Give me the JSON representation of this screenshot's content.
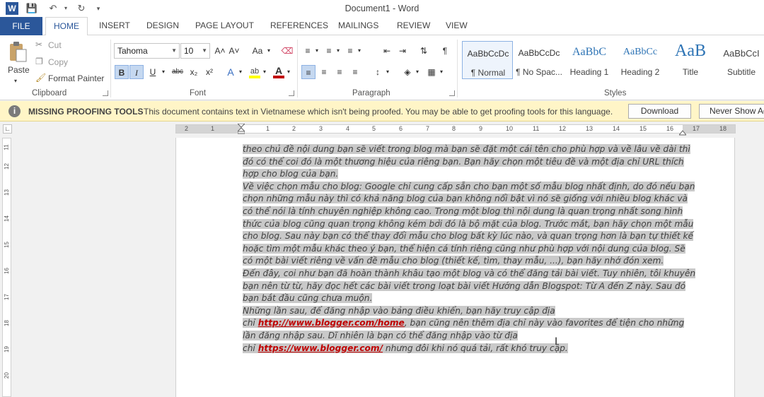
{
  "window": {
    "title": "Document1 - Word"
  },
  "tabs": [
    "FILE",
    "HOME",
    "INSERT",
    "DESIGN",
    "PAGE LAYOUT",
    "REFERENCES",
    "MAILINGS",
    "REVIEW",
    "VIEW"
  ],
  "clipboard": {
    "paste": "Paste",
    "cut": "Cut",
    "copy": "Copy",
    "format_painter": "Format Painter",
    "label": "Clipboard"
  },
  "font": {
    "name": "Tahoma",
    "size": "10",
    "label": "Font",
    "bold": "B",
    "italic": "I",
    "underline": "U",
    "strike": "abc",
    "sub": "x₂",
    "sup": "x²",
    "grow": "A˄",
    "shrink": "A˅",
    "case": "Aa"
  },
  "paragraph": {
    "label": "Paragraph"
  },
  "styles": {
    "label": "Styles",
    "items": [
      {
        "preview": "AaBbCcDc",
        "name": "¶ Normal"
      },
      {
        "preview": "AaBbCcDc",
        "name": "¶ No Spac..."
      },
      {
        "preview": "AaBbC",
        "name": "Heading 1"
      },
      {
        "preview": "AaBbCc",
        "name": "Heading 2"
      },
      {
        "preview": "AaB",
        "name": "Title"
      },
      {
        "preview": "AaBbCcI",
        "name": "Subtitle"
      }
    ]
  },
  "message_bar": {
    "title": "MISSING PROOFING TOOLS",
    "text": "This document contains text in Vietnamese which isn't being proofed. You may be able to get proofing tools for this language.",
    "download": "Download",
    "never_show": "Never Show Ag"
  },
  "ruler": {
    "h_ticks": [
      "2",
      "1",
      "1",
      "2",
      "3",
      "4",
      "5",
      "6",
      "7",
      "8",
      "9",
      "10",
      "11",
      "12",
      "13",
      "14",
      "15",
      "16",
      "17",
      "18"
    ],
    "v_ticks": [
      "11",
      "12",
      "13",
      "14",
      "15",
      "16",
      "17",
      "18",
      "19",
      "20"
    ]
  },
  "document": {
    "lines": [
      "theo chủ đề nội dung bạn sẽ viết trong blog mà bạn sẽ đặt một cái tên cho phù hợp và về lâu về dài thì",
      "đó có thể coi đó là một thương hiệu của riêng bạn. Bạn hãy chọn một tiêu đề và một địa chỉ URL thích",
      "hợp cho blog của bạn.",
      "Về việc chọn mẫu cho blog: Google chỉ cung cấp sẵn cho bạn một số mẫu blog nhất định, do đó nếu bạn",
      "chọn những mẫu này thì có khả năng blog của bạn không nổi bật vì nó sẽ giống với nhiều blog khác và",
      "có thể nói là tính chuyên nghiệp không cao. Trong một blog thì nội dung là quan trọng nhất song hình",
      "thức của blog cũng quan trọng không kém bởi đó là bộ mặt của blog. Trước mắt, bạn hãy chọn một mẫu",
      "cho blog. Sau này bạn có thể thay đổi mẫu cho blog bất kỳ lúc nào, và quan trọng hơn là bạn tự thiết kế",
      "hoặc tìm một mẫu khác theo ý bạn, thể hiện cá tính riêng cũng như phù hợp với nội dung của blog. Sẽ",
      "có một bài viết riêng về vấn đề mẫu cho blog (thiết kế, tìm, thay mẫu, ...), bạn hãy nhớ đón xem.",
      "Đến đây, coi như bạn đã hoàn thành khâu tạo một blog và có thể đăng tải bài viết. Tuy nhiên, tôi khuyên",
      "bạn nên từ từ, hãy đọc hết các bài viết trong loạt bài viết Hướng dẫn Blogspot: Từ A đến Z này. Sau đó",
      "bạn bắt đầu cũng chưa muộn.",
      "Những lần sau, để đăng nhập vào bảng điều khiển, bạn hãy truy cập địa"
    ],
    "link1_prefix": "chỉ ",
    "link1": "http://www.blogger.com/home",
    "link1_suffix": ", bạn cũng nên thêm địa chỉ này vào favorites để tiện cho những",
    "line_after": "lần đăng nhập sau. Dĩ nhiên là bạn có thể đăng nhập vào từ địa",
    "link2_prefix": "chỉ ",
    "link2": "https://www.blogger.com/",
    "link2_suffix": " nhưng đôi khi nó quá tải, rất khó truy cập."
  }
}
